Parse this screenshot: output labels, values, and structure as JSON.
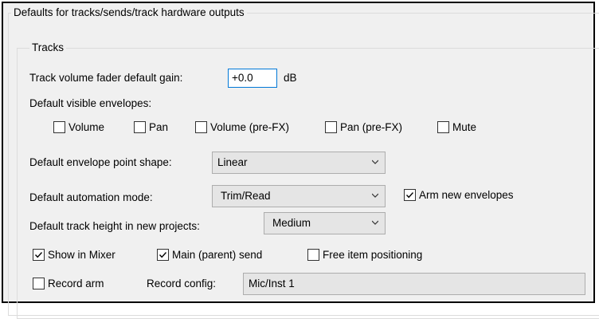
{
  "outer_group": {
    "title": "Defaults for tracks/sends/track hardware outputs"
  },
  "tracks_group": {
    "title": "Tracks",
    "volume_label": "Track volume fader default gain:",
    "volume_value": "+0.0",
    "volume_unit": "dB",
    "envelopes_label": "Default visible envelopes:",
    "envelopes": [
      {
        "label": "Volume",
        "checked": false
      },
      {
        "label": "Pan",
        "checked": false
      },
      {
        "label": "Volume (pre-FX)",
        "checked": false
      },
      {
        "label": "Pan (pre-FX)",
        "checked": false
      },
      {
        "label": "Mute",
        "checked": false
      }
    ],
    "shape_label": "Default envelope point shape:",
    "shape_value": "Linear",
    "automation_label": "Default automation mode:",
    "automation_value": "Trim/Read",
    "arm_envelopes": {
      "label": "Arm new envelopes",
      "checked": true
    },
    "height_label": "Default track height in new projects:",
    "height_value": "Medium",
    "show_in_mixer": {
      "label": "Show in Mixer",
      "checked": true
    },
    "main_send": {
      "label": "Main (parent) send",
      "checked": true
    },
    "free_item": {
      "label": "Free item positioning",
      "checked": false
    },
    "record_arm": {
      "label": "Record arm",
      "checked": false
    },
    "record_config_label": "Record config:",
    "record_config_value": "Mic/Inst 1"
  }
}
